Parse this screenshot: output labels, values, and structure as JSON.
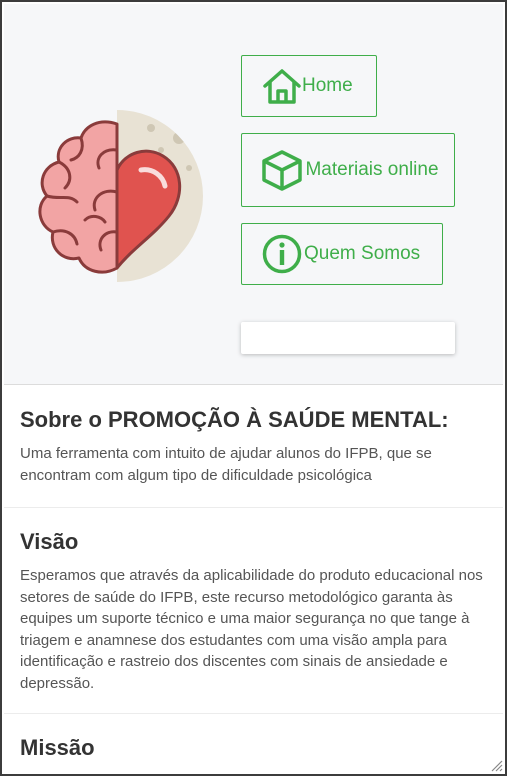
{
  "colors": {
    "accent": "#3fae4a",
    "hero_bg": "#f6f7f9",
    "heart": "#e0534f",
    "brain": "#f2a4a4"
  },
  "nav": {
    "home": {
      "label": "Home",
      "icon": "home-icon"
    },
    "materiais": {
      "label": "Materiais online",
      "icon": "cube-icon"
    },
    "quem_somos": {
      "label": "Quem Somos",
      "icon": "info-icon"
    }
  },
  "logo": {
    "icon": "brain-heart-logo"
  },
  "search": {
    "value": ""
  },
  "sobre": {
    "title": "Sobre o PROMOÇÃO À SAÚDE MENTAL:",
    "text": "Uma ferramenta com intuito de ajudar alunos do IFPB, que se encontram com algum tipo de dificuldade psicológica"
  },
  "visao": {
    "title": "Visão",
    "text": "Esperamos que através da aplicabilidade do produto educacional nos setores de saúde do IFPB, este recurso metodológico garanta às equipes um suporte técnico e uma maior segurança no que tange à triagem e anamnese dos estudantes com uma visão ampla para identificação e rastreio dos discentes com sinais de ansiedade e depressão."
  },
  "missao": {
    "title": "Missão"
  }
}
